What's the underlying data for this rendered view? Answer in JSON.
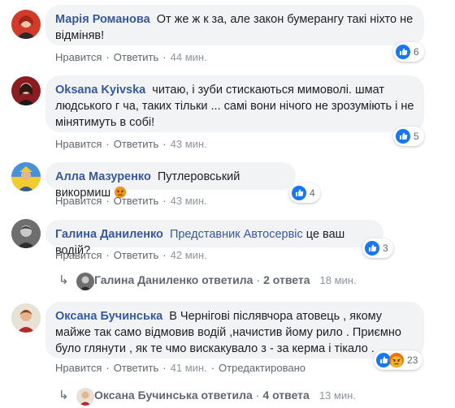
{
  "actions": {
    "like": "Нравится",
    "reply": "Ответить",
    "separator": "·"
  },
  "colors": {
    "link_blue": "#385898",
    "bubble_bg": "#f2f3f5",
    "like_blue": "#1877f2",
    "angry_orange": "#e9710f"
  },
  "comments": [
    {
      "author": "Марія Романова",
      "text": "От же ж к   за, але закон бумерангу такі ніхто не відміняв!",
      "time": "44 мин.",
      "reactions": {
        "icons": [
          "like-icon"
        ],
        "count": "6"
      }
    },
    {
      "author": "Oksana Kyivska",
      "text": "читаю, і зуби стискаються мимоволі. шмат людського г  ча, таких тільки ... самі вони нічого не зрозуміють і не мінятимуть в собі!",
      "time": "43 мин.",
      "reactions": {
        "icons": [
          "like-icon"
        ],
        "count": "5"
      }
    },
    {
      "author": "Алла Мазуренко",
      "text": "Путлеровський викормиш",
      "emoji": "angry-emoji",
      "time": "43 мин.",
      "reactions": {
        "icons": [
          "like-icon"
        ],
        "count": "4"
      }
    },
    {
      "author": "Галина Даниленко",
      "mention": "Представник Автосервіс",
      "text": "це ваш водій?",
      "time": "42 мин.",
      "reactions": {
        "icons": [
          "like-icon"
        ],
        "count": "3"
      },
      "replies": {
        "who": "Галина Даниленко ответила",
        "count": "2 ответа",
        "time": "18 мин."
      }
    },
    {
      "author": "Оксана Бучинська",
      "text": "В Чернігові післявчора атовець , якому майже так само відмовив водій ,начистив йому рило . Приємно було глянути , як те чмо вискакувало з - за керма і тікало .",
      "time": "41 мин.",
      "edited": "Отредактировано",
      "reactions": {
        "icons": [
          "like-icon",
          "angry-icon"
        ],
        "count": "23"
      },
      "replies": {
        "who": "Оксана Бучинська ответила",
        "count": "4 ответа",
        "time": "13 мин."
      }
    }
  ]
}
